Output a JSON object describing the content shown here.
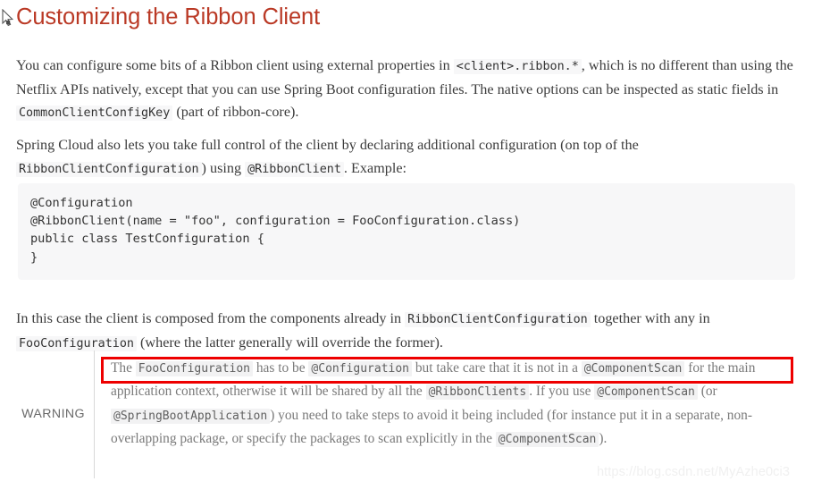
{
  "document": {
    "heading": "Customizing the Ribbon Client",
    "heading_color": "#ba3925",
    "background_color": "#ffffff",
    "body_text_color": "#3c3c3c"
  },
  "paragraphs": {
    "p1": {
      "seg1": "You can configure some bits of a Ribbon client using external properties in ",
      "code1": "<client>.ribbon.*",
      "seg2": ", which is no different than using the Netflix APIs natively, except that you can use Spring Boot configuration files. The native options can be inspected as static fields in ",
      "code2": "CommonClientConfigKey",
      "seg3": " (part of ribbon-core)."
    },
    "p2": {
      "seg1": "Spring Cloud also lets you take full control of the client by declaring additional configuration (on top of the ",
      "code1": "RibbonClientConfiguration",
      "seg2": ") using ",
      "code2": "@RibbonClient",
      "seg3": ". Example:"
    },
    "p3": {
      "seg1": "In this case the client is composed from the components already in ",
      "code1": "RibbonClientConfiguration",
      "seg2": " together with any in ",
      "code2": "FooConfiguration",
      "seg3": " (where the latter generally will override the former)."
    }
  },
  "code_block": {
    "language": "java",
    "background_color": "#f7f7f8",
    "content": "@Configuration\n@RibbonClient(name = \"foo\", configuration = FooConfiguration.class)\npublic class TestConfiguration {\n}"
  },
  "admonition": {
    "label": "WARNING",
    "type": "warning",
    "text_color": "#7a7a7a",
    "line1_seg1": "The ",
    "line1_code1": "FooConfiguration",
    "line1_seg2": " has to be ",
    "line1_code2": "@Configuration",
    "line1_seg3": " but take care that it is not in a ",
    "line1_code3": "@ComponentScan",
    "line2_seg1": " for the main application context, otherwise it will be shared by all the ",
    "line2_code1": "@RibbonClients",
    "line2_seg2": ". If you use ",
    "line3_code1": "@ComponentScan",
    "line3_seg1": " (or ",
    "line3_code2": "@SpringBootApplication",
    "line3_seg2": ") you need to take steps to avoid it being included (for instance put it in a separate, non-overlapping package, or specify the packages to scan explicitly in the ",
    "line4_code1": "@ComponentScan",
    "line4_seg1": ")."
  },
  "annotation": {
    "highlight_box_color": "#ee0000",
    "highlight_box_label": "red-rectangle-highlight"
  },
  "watermark": {
    "text": "https://blog.csdn.net/MyAzhe0ci3",
    "color": "#f0f0f0"
  }
}
